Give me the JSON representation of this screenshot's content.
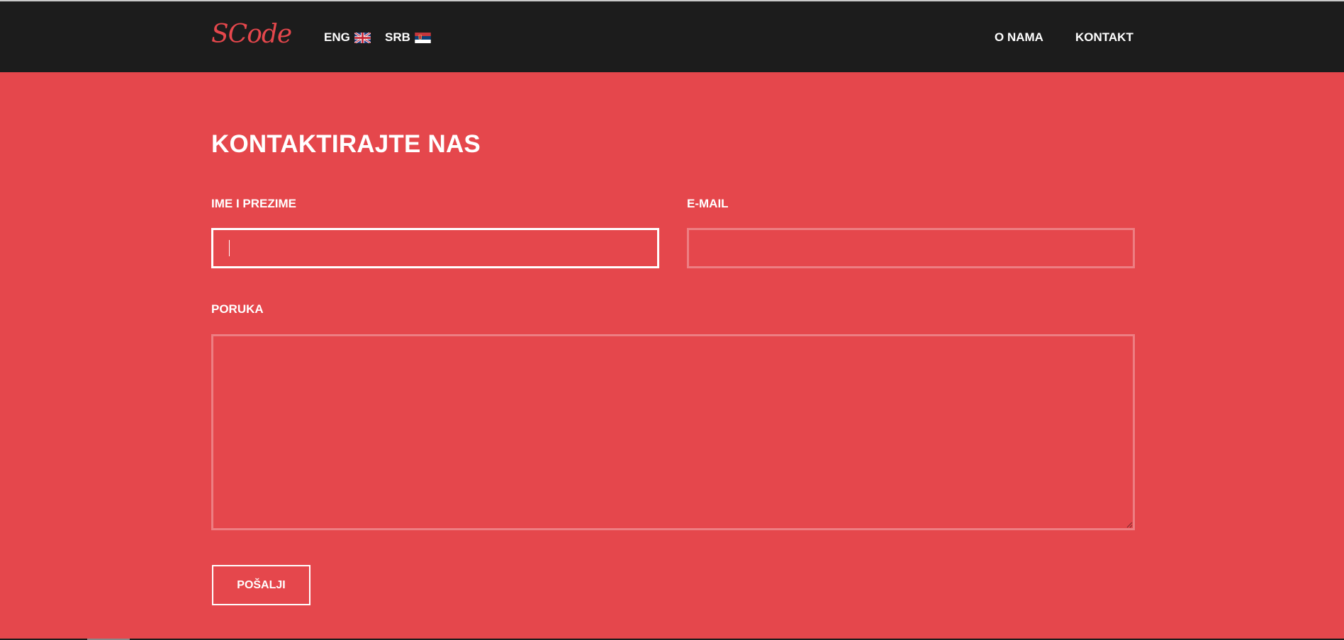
{
  "brand": {
    "logo": "SCode",
    "accent_color": "#e5474c",
    "nav_bg": "#1c1c1c"
  },
  "languages": [
    {
      "code": "ENG",
      "flag_icon": "uk-flag-icon"
    },
    {
      "code": "SRB",
      "flag_icon": "serbia-flag-icon"
    }
  ],
  "nav": {
    "about": "O NAMA",
    "contact": "KONTAKT"
  },
  "form": {
    "title": "KONTAKTIRAJTE NAS",
    "name_label": "IME I PREZIME",
    "name_value": "",
    "email_label": "E-MAIL",
    "email_value": "",
    "message_label": "PORUKA",
    "message_value": "",
    "submit_label": "POŠALJI"
  }
}
